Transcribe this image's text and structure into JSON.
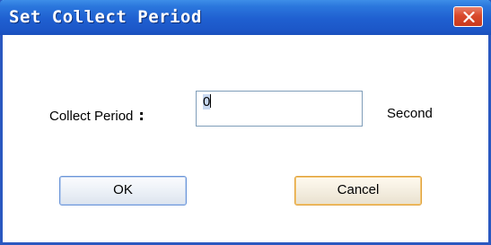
{
  "window": {
    "title": "Set Collect Period",
    "close_icon": "close-icon"
  },
  "form": {
    "period_label": "Collect Period",
    "colon": ":",
    "period_value": "0",
    "unit_label": "Second"
  },
  "buttons": {
    "ok_label": "OK",
    "cancel_label": "Cancel"
  },
  "colors": {
    "titlebar": "#1f5fd0",
    "close_button": "#d9492c",
    "focus_ring": "#e0a23c"
  }
}
